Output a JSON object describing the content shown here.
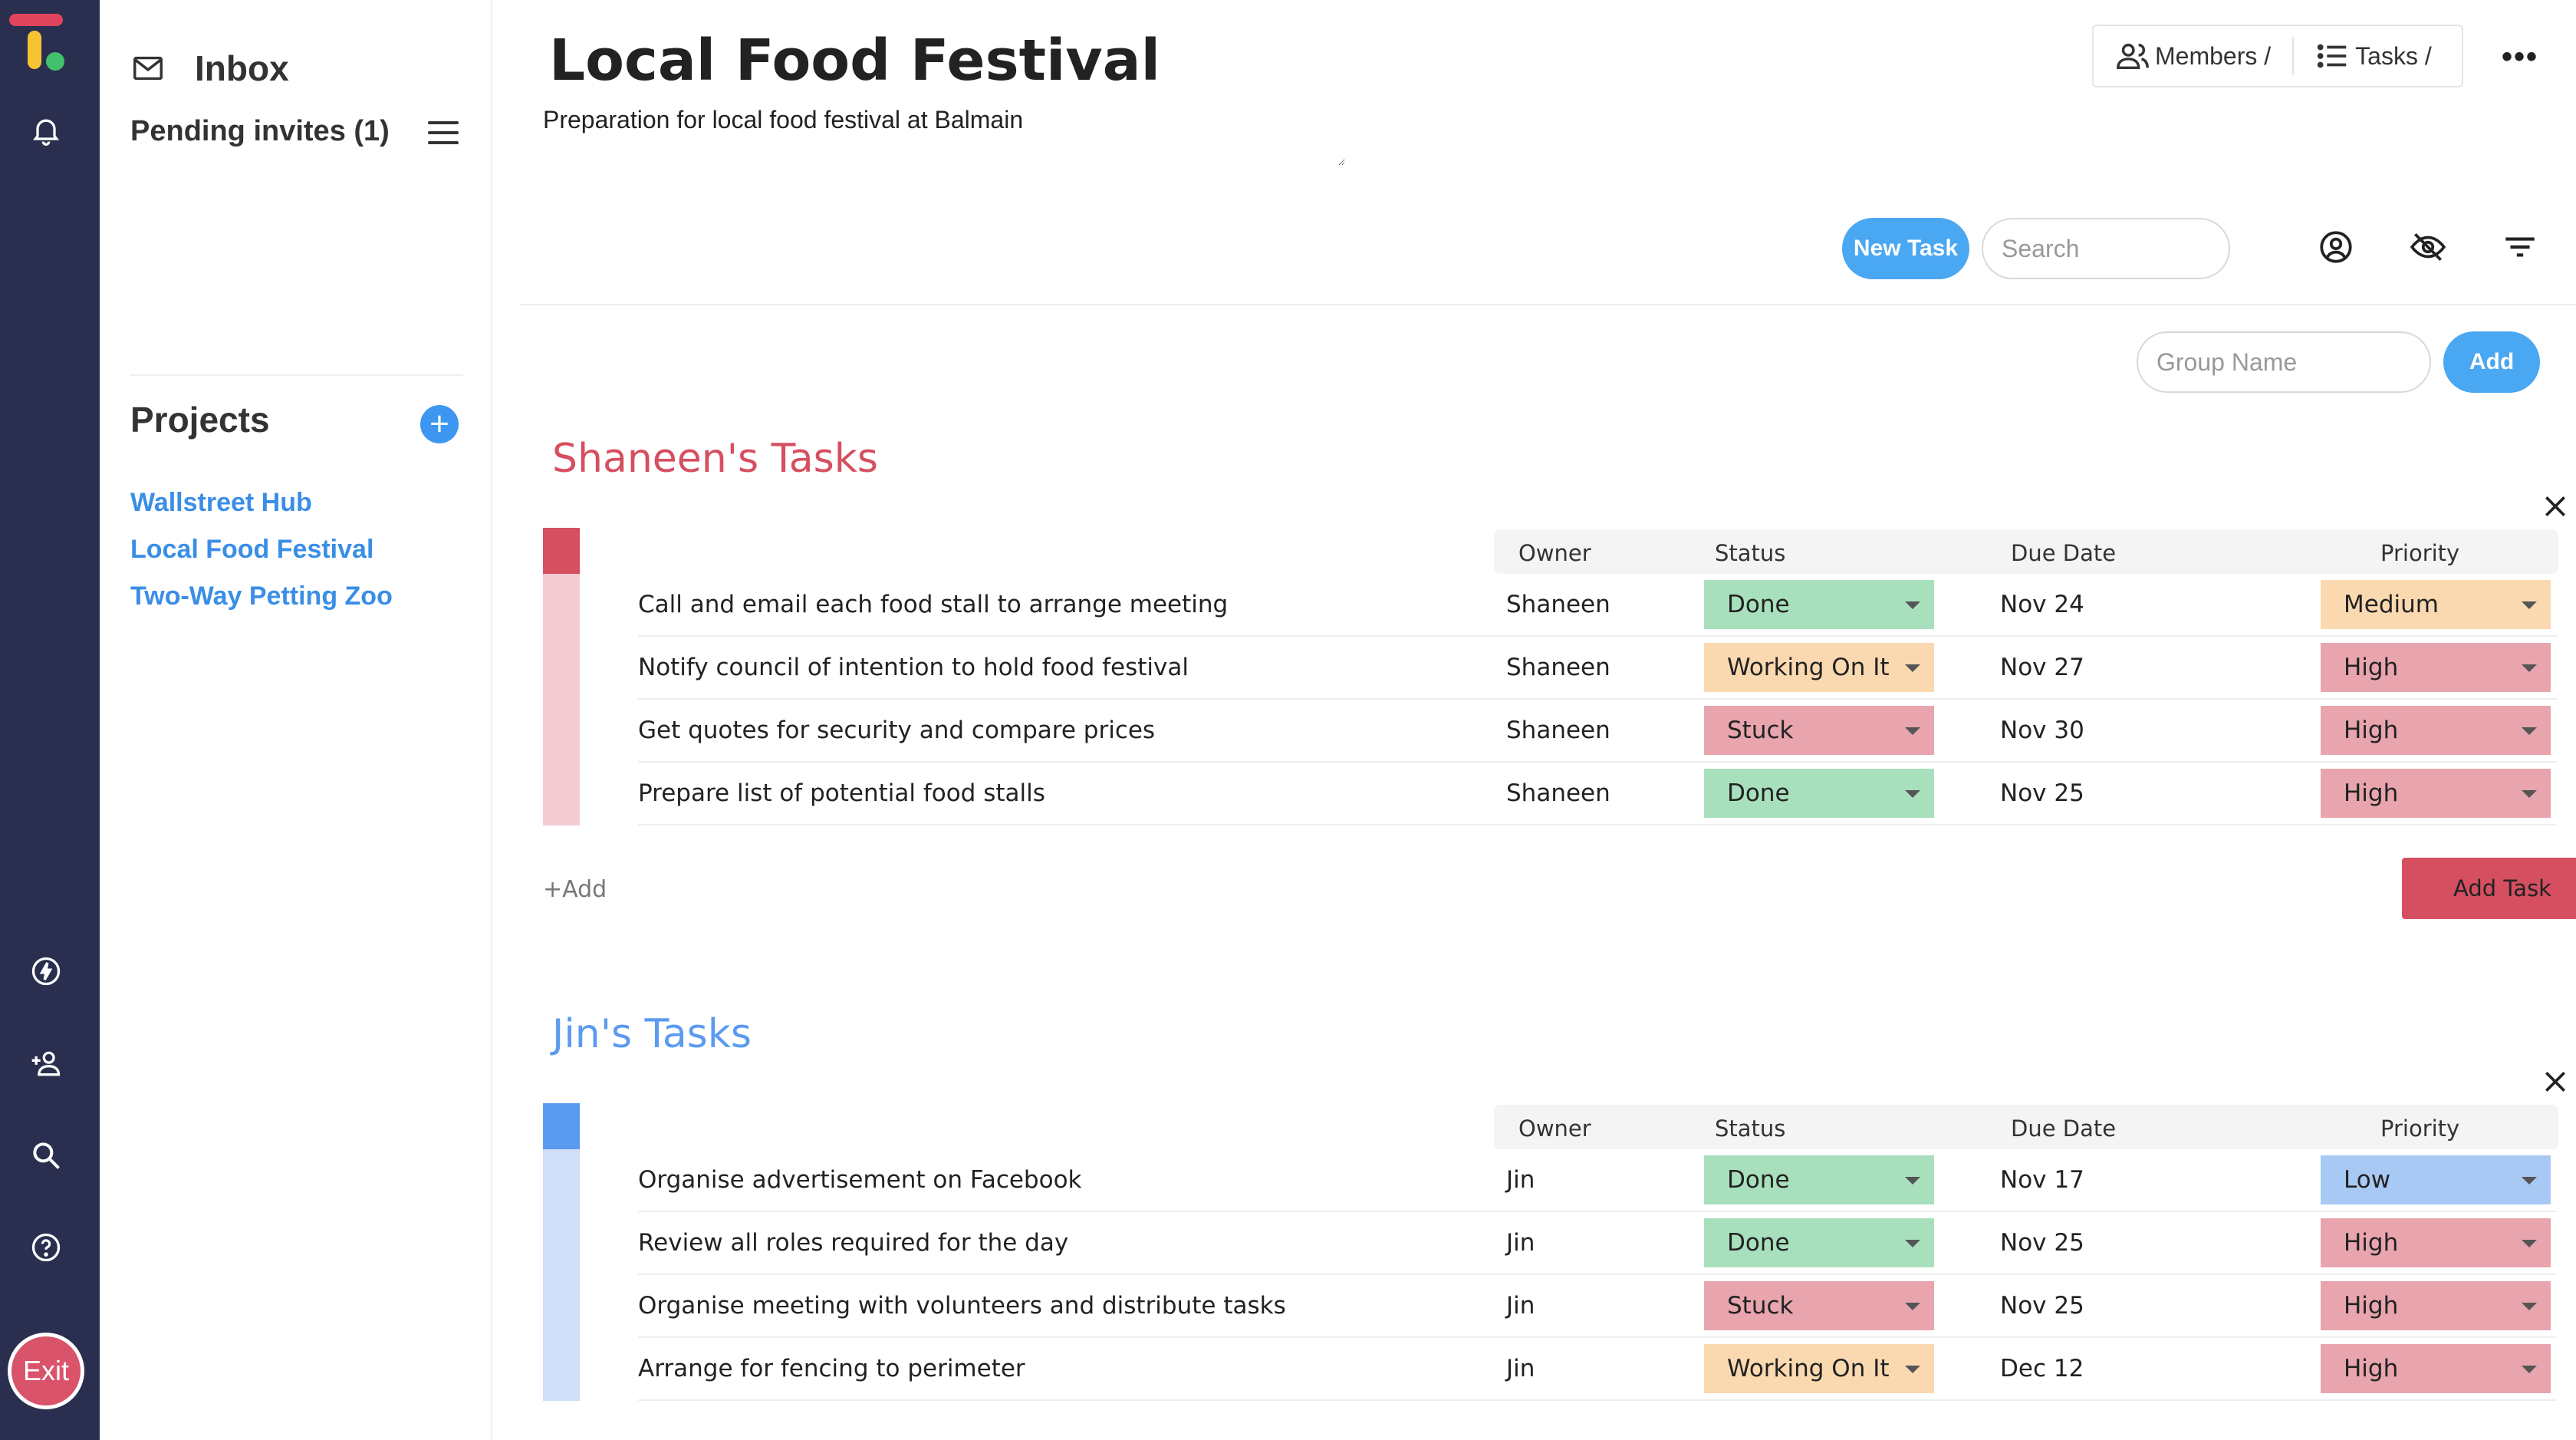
{
  "rail": {
    "icons": [
      "bell-icon",
      "bolt-icon",
      "add-person-icon",
      "search-icon",
      "help-icon"
    ],
    "exit_label": "Exit"
  },
  "panel": {
    "inbox_label": "Inbox",
    "pending_invites": "Pending invites (1)",
    "projects_title": "Projects",
    "projects": [
      "Wallstreet Hub",
      "Local Food Festival",
      "Two-Way Petting Zoo"
    ]
  },
  "header": {
    "title": "Local Food Festival",
    "description": "Preparation for local food festival at Balmain",
    "members_label": "Members /",
    "tasks_label": "Tasks /",
    "more_label": "•••"
  },
  "toolbar": {
    "new_task_label": "New Task",
    "search_placeholder": "Search",
    "group_name_placeholder": "Group Name",
    "add_group_label": "Add"
  },
  "columns": {
    "owner": "Owner",
    "status": "Status",
    "due_date": "Due Date",
    "priority": "Priority"
  },
  "status_colors": {
    "Done": "#a8e0bd",
    "Working On It": "#fbd9b0",
    "Stuck": "#e8a5ae"
  },
  "priority_colors": {
    "Medium": "#fbd9b0",
    "High": "#e8a5ae",
    "Low": "#a9c9f5"
  },
  "groups": [
    {
      "title": "Shaneen's Tasks",
      "color": "#d64f60",
      "row_color": "#f3cdd2",
      "tasks": [
        {
          "name": "Call and email each food stall to arrange meeting",
          "owner": "Shaneen",
          "status": "Done",
          "due": "Nov 24",
          "priority": "Medium"
        },
        {
          "name": "Notify council of intention to hold food festival",
          "owner": "Shaneen",
          "status": "Working On It",
          "due": "Nov 27",
          "priority": "High"
        },
        {
          "name": "Get quotes for security and compare prices",
          "owner": "Shaneen",
          "status": "Stuck",
          "due": "Nov 30",
          "priority": "High"
        },
        {
          "name": "Prepare list of potential food stalls",
          "owner": "Shaneen",
          "status": "Done",
          "due": "Nov 25",
          "priority": "High"
        }
      ],
      "add_label": "+Add",
      "add_task_label": "Add Task"
    },
    {
      "title": "Jin's Tasks",
      "color": "#5b9bef",
      "row_color": "#cfdff8",
      "tasks": [
        {
          "name": "Organise advertisement on Facebook",
          "owner": "Jin",
          "status": "Done",
          "due": "Nov 17",
          "priority": "Low"
        },
        {
          "name": "Review all roles required for the day",
          "owner": "Jin",
          "status": "Done",
          "due": "Nov 25",
          "priority": "High"
        },
        {
          "name": "Organise meeting with volunteers and distribute tasks",
          "owner": "Jin",
          "status": "Stuck",
          "due": "Nov 25",
          "priority": "High"
        },
        {
          "name": "Arrange for fencing to perimeter",
          "owner": "Jin",
          "status": "Working On It",
          "due": "Dec 12",
          "priority": "High"
        }
      ]
    }
  ]
}
